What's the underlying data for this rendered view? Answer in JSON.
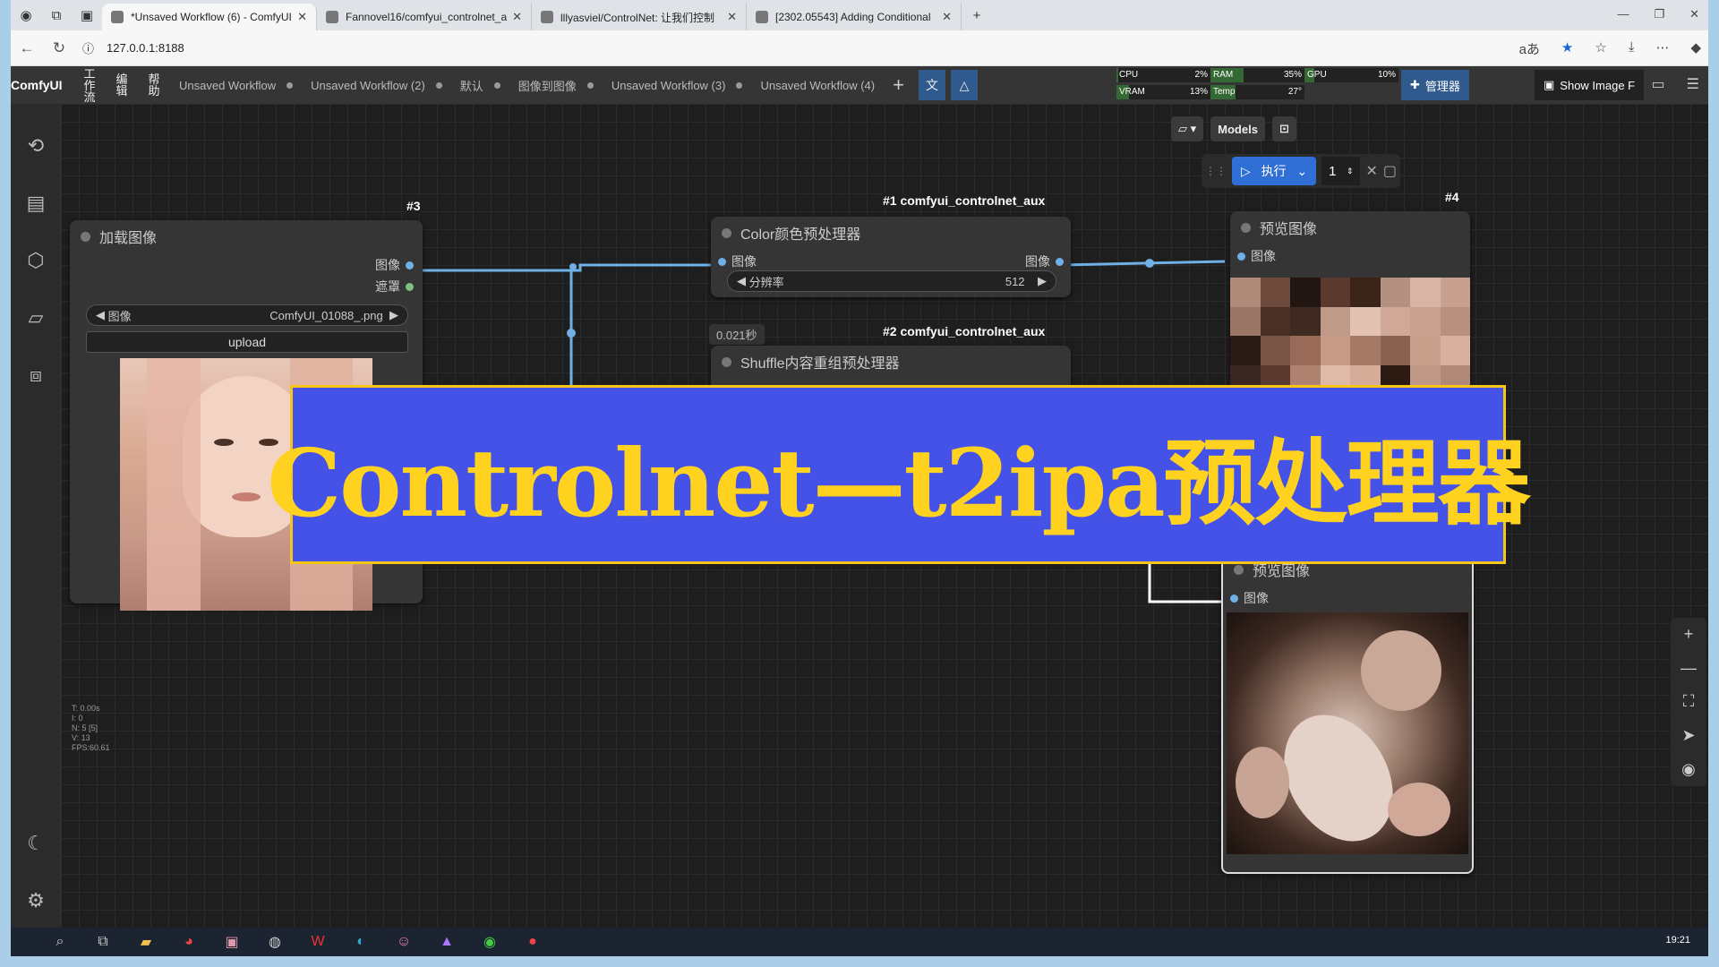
{
  "browser": {
    "tabs": [
      {
        "title": "*Unsaved Workflow (6) - ComfyUI",
        "active": true
      },
      {
        "title": "Fannovel16/comfyui_controlnet_a",
        "active": false
      },
      {
        "title": "lllyasviel/ControlNet: 让我们控制",
        "active": false
      },
      {
        "title": "[2302.05543] Adding Conditional",
        "active": false
      }
    ],
    "url": "127.0.0.1:8188"
  },
  "menubar": {
    "brand": "ComfyUI",
    "menus": [
      "工\n作\n流",
      "编\n辑",
      "帮\n助"
    ],
    "workflow_tabs": [
      "Unsaved Workflow",
      "Unsaved Workflow (2)",
      "默认",
      "图像到图像",
      "Unsaved Workflow (3)",
      "Unsaved Workflow (4)"
    ],
    "status": "idle",
    "stats": [
      {
        "label": "CPU",
        "value": "2%",
        "pct": 2
      },
      {
        "label": "RAM",
        "value": "35%",
        "pct": 35
      },
      {
        "label": "GPU",
        "value": "10%",
        "pct": 10
      },
      {
        "label": "VRAM",
        "value": "13%",
        "pct": 13
      },
      {
        "label": "Temp",
        "value": "27°",
        "pct": 27
      }
    ],
    "manager_label": "管理器",
    "show_image_label": "Show Image F"
  },
  "canvas": {
    "models_label": "Models",
    "run_label": "执行",
    "run_count": "1",
    "nodes": {
      "load_image": {
        "badge": "#3",
        "title": "加载图像",
        "out_image": "图像",
        "out_mask": "遮罩",
        "widget_label": "图像",
        "widget_value": "ComfyUI_01088_.png",
        "upload_label": "upload"
      },
      "color_pre": {
        "badge": "#1 comfyui_controlnet_aux",
        "title": "Color颜色预处理器",
        "in_image": "图像",
        "out_image": "图像",
        "widget_label": "分辨率",
        "widget_value": "512",
        "timing": "0.021秒"
      },
      "shuffle_pre": {
        "badge": "#2 comfyui_controlnet_aux",
        "title": "Shuffle内容重组预处理器"
      },
      "preview1": {
        "badge": "#4",
        "title": "预览图像",
        "in_image": "图像"
      },
      "preview2": {
        "title": "预览图像",
        "in_image": "图像"
      }
    },
    "perf": [
      "T: 0.00s",
      "I: 0",
      "N: 5 [5]",
      "V: 13",
      "FPS:60.61"
    ]
  },
  "banner": {
    "text": "Controlnet—t2ipa预处理器"
  },
  "taskbar": {
    "time": "19:21"
  },
  "colors": {
    "banner_bg": "#4452e8",
    "banner_text": "#ffd21f",
    "link": "#6fb0e6",
    "accent": "#2f5a8e"
  }
}
